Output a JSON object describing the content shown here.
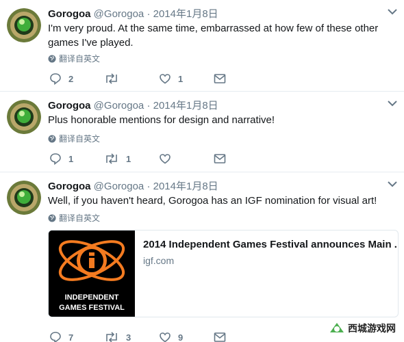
{
  "tweets": [
    {
      "name": "Gorogoa",
      "handle": "@Gorogoa",
      "separator": "·",
      "date": "2014年1月8日",
      "text": "I'm very proud. At the same time, embarrassed at how few of these other games I've played.",
      "translate_label": "翻译自英文",
      "replies": "2",
      "retweets": "",
      "likes": "1"
    },
    {
      "name": "Gorogoa",
      "handle": "@Gorogoa",
      "separator": "·",
      "date": "2014年1月8日",
      "text": "Plus honorable mentions for design and narrative!",
      "translate_label": "翻译自英文",
      "replies": "1",
      "retweets": "1",
      "likes": ""
    },
    {
      "name": "Gorogoa",
      "handle": "@Gorogoa",
      "separator": "·",
      "date": "2014年1月8日",
      "text": "Well, if you haven't heard, Gorogoa has an IGF nomination for visual art!",
      "translate_label": "翻译自英文",
      "replies": "7",
      "retweets": "3",
      "likes": "9",
      "card": {
        "title": "2014 Independent Games Festival announces Main ...",
        "domain": "igf.com",
        "logo_line1": "INDEPENDENT",
        "logo_line2": "GAMES FESTIVAL"
      }
    }
  ],
  "watermark": {
    "text": "西城游戏网"
  },
  "colors": {
    "text": "#14171a",
    "muted": "#657786",
    "border": "#e6ecf0",
    "igf_orange": "#f47b20"
  },
  "icons": [
    "reply-icon",
    "retweet-icon",
    "like-icon",
    "message-icon",
    "globe-icon",
    "chevron-down-icon"
  ]
}
